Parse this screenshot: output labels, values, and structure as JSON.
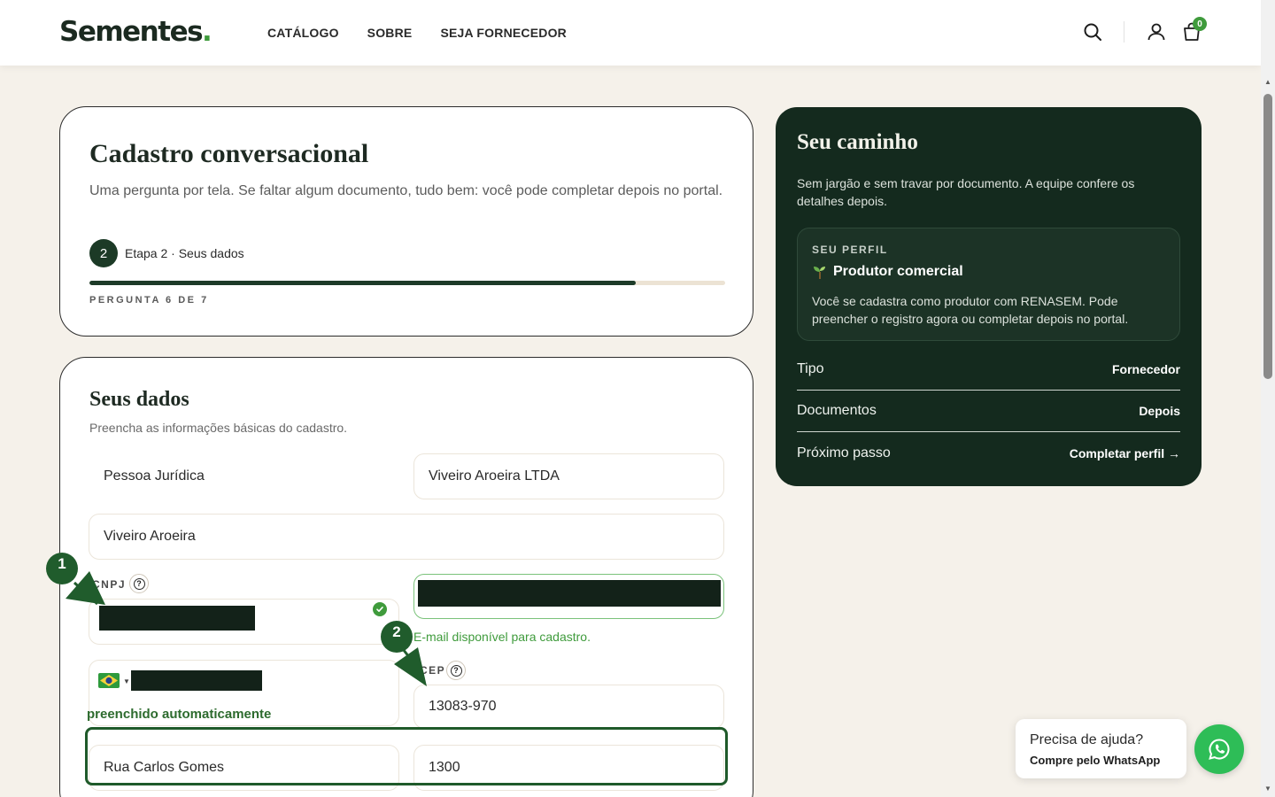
{
  "header": {
    "logo": "Sementes",
    "logo_dot": ".",
    "nav": [
      "CATÁLOGO",
      "SOBRE",
      "SEJA FORNECEDOR"
    ],
    "cart_count": "0",
    "icons": [
      "search-icon",
      "user-icon",
      "cart-icon"
    ]
  },
  "progress_card": {
    "title": "Cadastro conversacional",
    "subtitle": "Uma pergunta por tela. Se faltar algum documento, tudo bem: você pode completar depois no portal.",
    "step_number": "2",
    "step_label": "Etapa 2 · Seus dados",
    "question_counter": "PERGUNTA 6 DE 7",
    "progress": 0.86
  },
  "form": {
    "title": "Seus dados",
    "subtitle": "Preencha as informações básicas do cadastro.",
    "person_type": "Pessoa Jurídica",
    "company_name": "Viveiro Aroeira LTDA",
    "trade_name": "Viveiro Aroeira",
    "cnpj_label": "CNPJ",
    "email_status": "E-mail disponível para cadastro.",
    "cep_label": "CEP",
    "cep_value": "13083-970",
    "autofill_label": "preenchido automaticamente",
    "street": "Rua Carlos Gomes",
    "number": "1300"
  },
  "annotations": {
    "marker_1": "1",
    "marker_2": "2"
  },
  "sidebar": {
    "title": "Seu caminho",
    "subtitle": "Sem jargão e sem travar por documento. A equipe confere os detalhes depois.",
    "profile_eyebrow": "SEU PERFIL",
    "profile_name": "Produtor comercial",
    "profile_desc": "Você se cadastra como produtor com RENASEM. Pode preencher o registro agora ou completar depois no portal.",
    "rows": [
      {
        "label": "Tipo",
        "value": "Fornecedor"
      },
      {
        "label": "Documentos",
        "value": "Depois"
      },
      {
        "label": "Próximo passo",
        "value": "Completar perfil →"
      }
    ]
  },
  "help": {
    "title": "Precisa de ajuda?",
    "subtitle": "Compre pelo WhatsApp"
  },
  "colors": {
    "brand_dark": "#142a1e",
    "accent_green": "#3f9b3c",
    "whatsapp": "#2ebd57",
    "background": "#f5f1ea"
  }
}
